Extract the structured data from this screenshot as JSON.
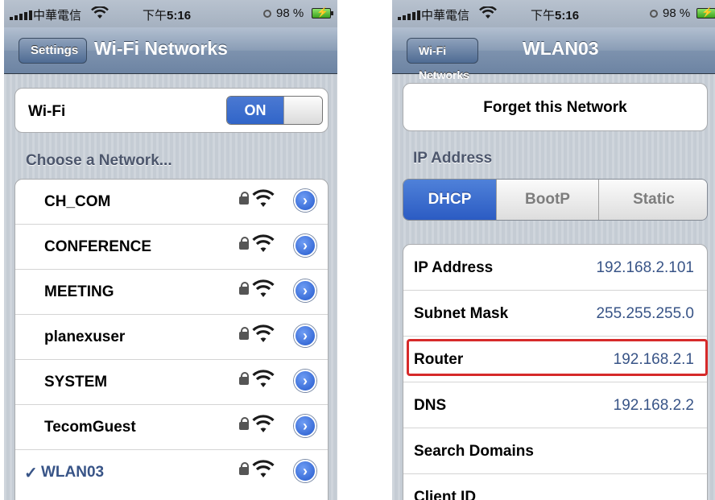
{
  "status_bar": {
    "carrier": "中華電信",
    "time_prefix": "下午",
    "time": "5:16",
    "battery_percent": "98 %"
  },
  "left_screen": {
    "back_button": "Settings",
    "title": "Wi-Fi Networks",
    "wifi_label": "Wi-Fi",
    "wifi_toggle": "ON",
    "section_header": "Choose a Network...",
    "networks": [
      {
        "name": "CH_COM",
        "secured": true,
        "selected": false
      },
      {
        "name": "CONFERENCE",
        "secured": true,
        "selected": false
      },
      {
        "name": "MEETING",
        "secured": true,
        "selected": false
      },
      {
        "name": "planexuser",
        "secured": true,
        "selected": false
      },
      {
        "name": "SYSTEM",
        "secured": true,
        "selected": false
      },
      {
        "name": "TecomGuest",
        "secured": true,
        "selected": false
      },
      {
        "name": "WLAN03",
        "secured": true,
        "selected": true
      }
    ],
    "selected_mark": "✓"
  },
  "right_screen": {
    "back_button": "Wi-Fi Networks",
    "title": "WLAN03",
    "forget_button": "Forget this Network",
    "section_header": "IP Address",
    "segments": [
      {
        "label": "DHCP",
        "selected": true
      },
      {
        "label": "BootP",
        "selected": false
      },
      {
        "label": "Static",
        "selected": false
      }
    ],
    "fields": [
      {
        "label": "IP Address",
        "value": "192.168.2.101"
      },
      {
        "label": "Subnet Mask",
        "value": "255.255.255.0"
      },
      {
        "label": "Router",
        "value": "192.168.2.1"
      },
      {
        "label": "DNS",
        "value": "192.168.2.2"
      },
      {
        "label": "Search Domains",
        "value": ""
      },
      {
        "label": "Client ID",
        "value": ""
      }
    ]
  },
  "colors": {
    "accent_blue": "#2f64c8",
    "value_text": "#385487",
    "highlight_red": "#d62a2a"
  }
}
